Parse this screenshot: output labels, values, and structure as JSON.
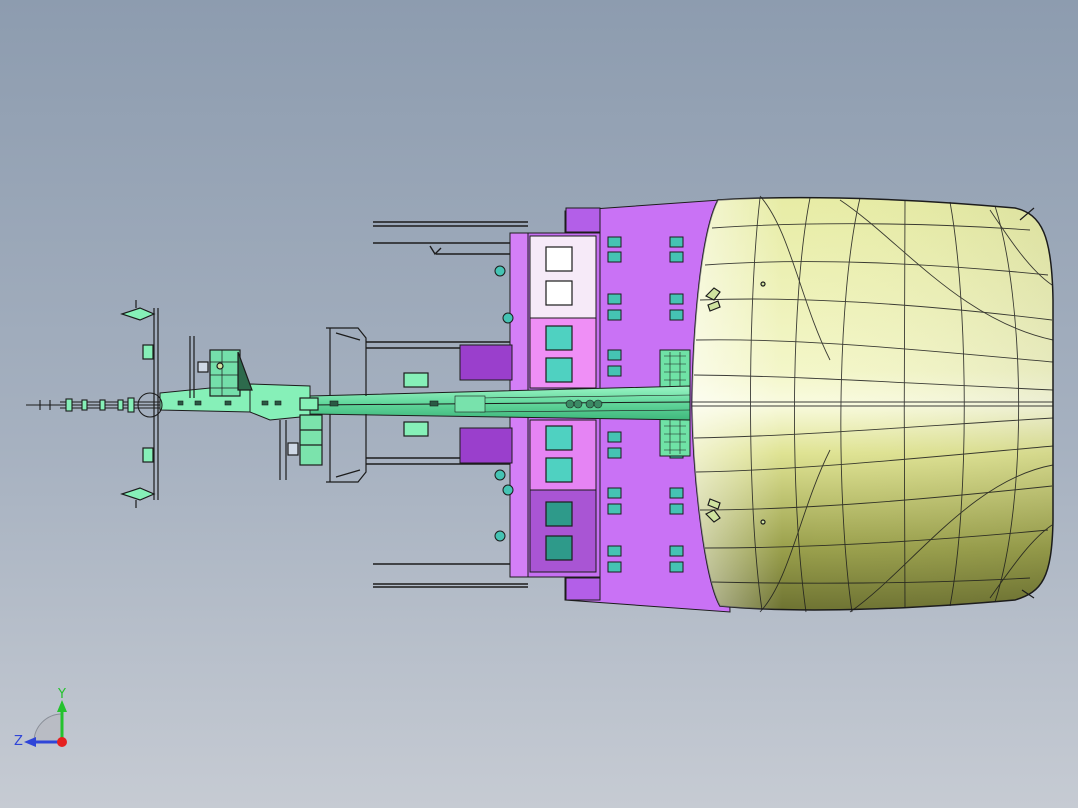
{
  "viewport": {
    "background_top": "#8d9caf",
    "background_bottom": "#c6cbd3"
  },
  "model": {
    "hull_color": "#ecf0ac",
    "superstructure_color": "#c972f5",
    "deck_color": "#86f0b8",
    "window_color": "#45c3b3",
    "line_color": "#1c1c1c"
  },
  "triad": {
    "y_label": "Y",
    "z_label": "Z",
    "y_color": "#24c22e",
    "z_color": "#2f45d8",
    "x_color": "#e52020"
  }
}
